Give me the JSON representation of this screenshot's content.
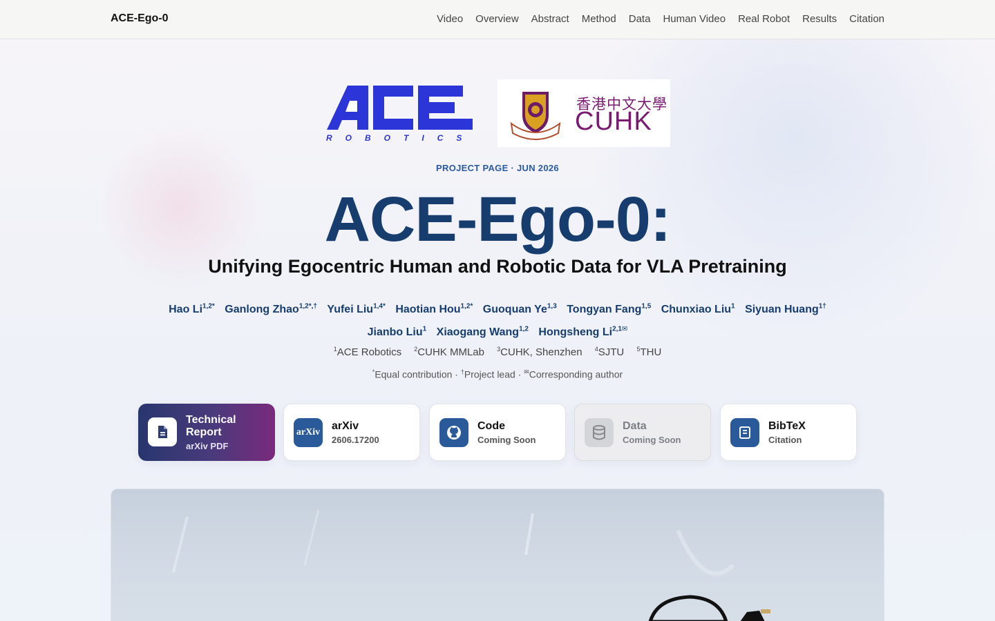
{
  "nav": {
    "brand": "ACE-Ego-0",
    "links": [
      "Video",
      "Overview",
      "Abstract",
      "Method",
      "Data",
      "Human Video",
      "Real Robot",
      "Results",
      "Citation"
    ]
  },
  "logos": {
    "ace_text": "ACE",
    "ace_sub": "ROBOTICS",
    "cuhk_zh": "香港中文大學",
    "cuhk_en": "CUHK"
  },
  "hero": {
    "eyebrow": "PROJECT PAGE · JUN 2026",
    "title": "ACE-Ego-0:",
    "subtitle": "Unifying Egocentric Human and Robotic Data for VLA Pretraining"
  },
  "authors": [
    {
      "name": "Hao Li",
      "sup": "1,2*"
    },
    {
      "name": "Ganlong Zhao",
      "sup": "1,2*,†"
    },
    {
      "name": "Yufei Liu",
      "sup": "1,4*"
    },
    {
      "name": "Haotian Hou",
      "sup": "1,2*"
    },
    {
      "name": "Guoquan Ye",
      "sup": "1,3"
    },
    {
      "name": "Tongyan Fang",
      "sup": "1,5"
    },
    {
      "name": "Chunxiao Liu",
      "sup": "1"
    },
    {
      "name": "Siyuan Huang",
      "sup": "1†"
    },
    {
      "name": "Jianbo Liu",
      "sup": "1"
    },
    {
      "name": "Xiaogang Wang",
      "sup": "1,2"
    },
    {
      "name": "Hongsheng Li",
      "sup": "2,1✉"
    }
  ],
  "affiliations": [
    {
      "sup": "1",
      "name": "ACE Robotics"
    },
    {
      "sup": "2",
      "name": "CUHK MMLab"
    },
    {
      "sup": "3",
      "name": "CUHK, Shenzhen"
    },
    {
      "sup": "4",
      "name": "SJTU"
    },
    {
      "sup": "5",
      "name": "THU"
    }
  ],
  "notes": {
    "equal_sup": "*",
    "equal": "Equal contribution · ",
    "lead_sup": "†",
    "lead": "Project lead · ",
    "corr_sup": "✉",
    "corr": "Corresponding author"
  },
  "buttons": [
    {
      "label": "Technical Report",
      "sub": "arXiv PDF",
      "icon": "document-icon"
    },
    {
      "label": "arXiv",
      "sub": "2606.17200",
      "icon": "arxiv-icon",
      "icon_text": "arXiv"
    },
    {
      "label": "Code",
      "sub": "Coming Soon",
      "icon": "github-icon"
    },
    {
      "label": "Data",
      "sub": "Coming Soon",
      "icon": "database-icon"
    },
    {
      "label": "BibTeX",
      "sub": "Citation",
      "icon": "quote-book-icon"
    }
  ],
  "colors": {
    "accent": "#173d6e",
    "ace_blue": "#2b35d8",
    "cuhk_purple": "#7a1b72"
  }
}
